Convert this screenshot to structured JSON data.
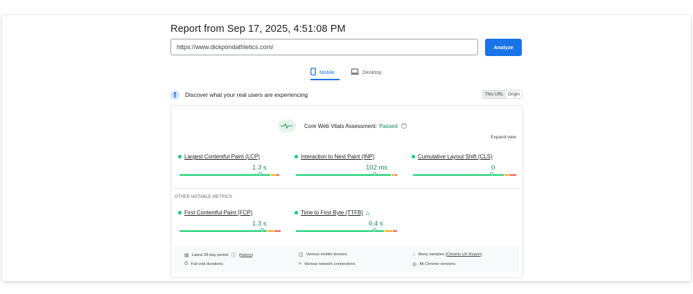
{
  "report": {
    "title": "Report from Sep 17, 2025, 4:51:08 PM",
    "url_value": "https://www.dickpondathletics.com/",
    "analyze_label": "Analyze"
  },
  "tabs": [
    {
      "label": "Mobile",
      "icon": "phone-icon",
      "selected": true
    },
    {
      "label": "Desktop",
      "icon": "laptop-icon",
      "selected": false
    }
  ],
  "discover": {
    "text": "Discover what your real users are experiencing",
    "toggle_url": "This URL",
    "toggle_origin": "Origin"
  },
  "cwv": {
    "label": "Core Web Vitals Assessment:",
    "status": "Passed",
    "expand_label": "Expand view"
  },
  "metrics": [
    {
      "name": "Largest Contentful Paint (LCP)",
      "value": "1.3 s",
      "marker_fraction": 0.81
    },
    {
      "name": "Interaction to Next Paint (INP)",
      "value": "102 ms",
      "marker_fraction": 0.78
    },
    {
      "name": "Cumulative Layout Shift (CLS)",
      "value": "0",
      "marker_fraction": 0.76
    }
  ],
  "other_label": "OTHER NOTABLE METRICS",
  "other_metrics": [
    {
      "name": "First Contentful Paint (FCP)",
      "value": "1.3 s",
      "marker_fraction": 0.82,
      "experimental_icon": false
    },
    {
      "name": "Time to First Byte (TTFB)",
      "value": "0.4 s",
      "marker_fraction": 0.78,
      "experimental_icon": true
    }
  ],
  "footer": {
    "period": "Latest 28-day period",
    "history": "history",
    "durations": "Full visit durations",
    "devices": "Various mobile devices",
    "connections": "Various network connections",
    "samples_prefix": "Many samples (",
    "samples_link": "Chrome UX Report",
    "samples_suffix": ")",
    "versions": "All Chrome versions"
  },
  "colors": {
    "accent": "#1a73e8",
    "good": "#0cce6b",
    "needs_improvement": "#ffa400",
    "poor": "#ff4e42",
    "passed_text": "#0d904f"
  }
}
